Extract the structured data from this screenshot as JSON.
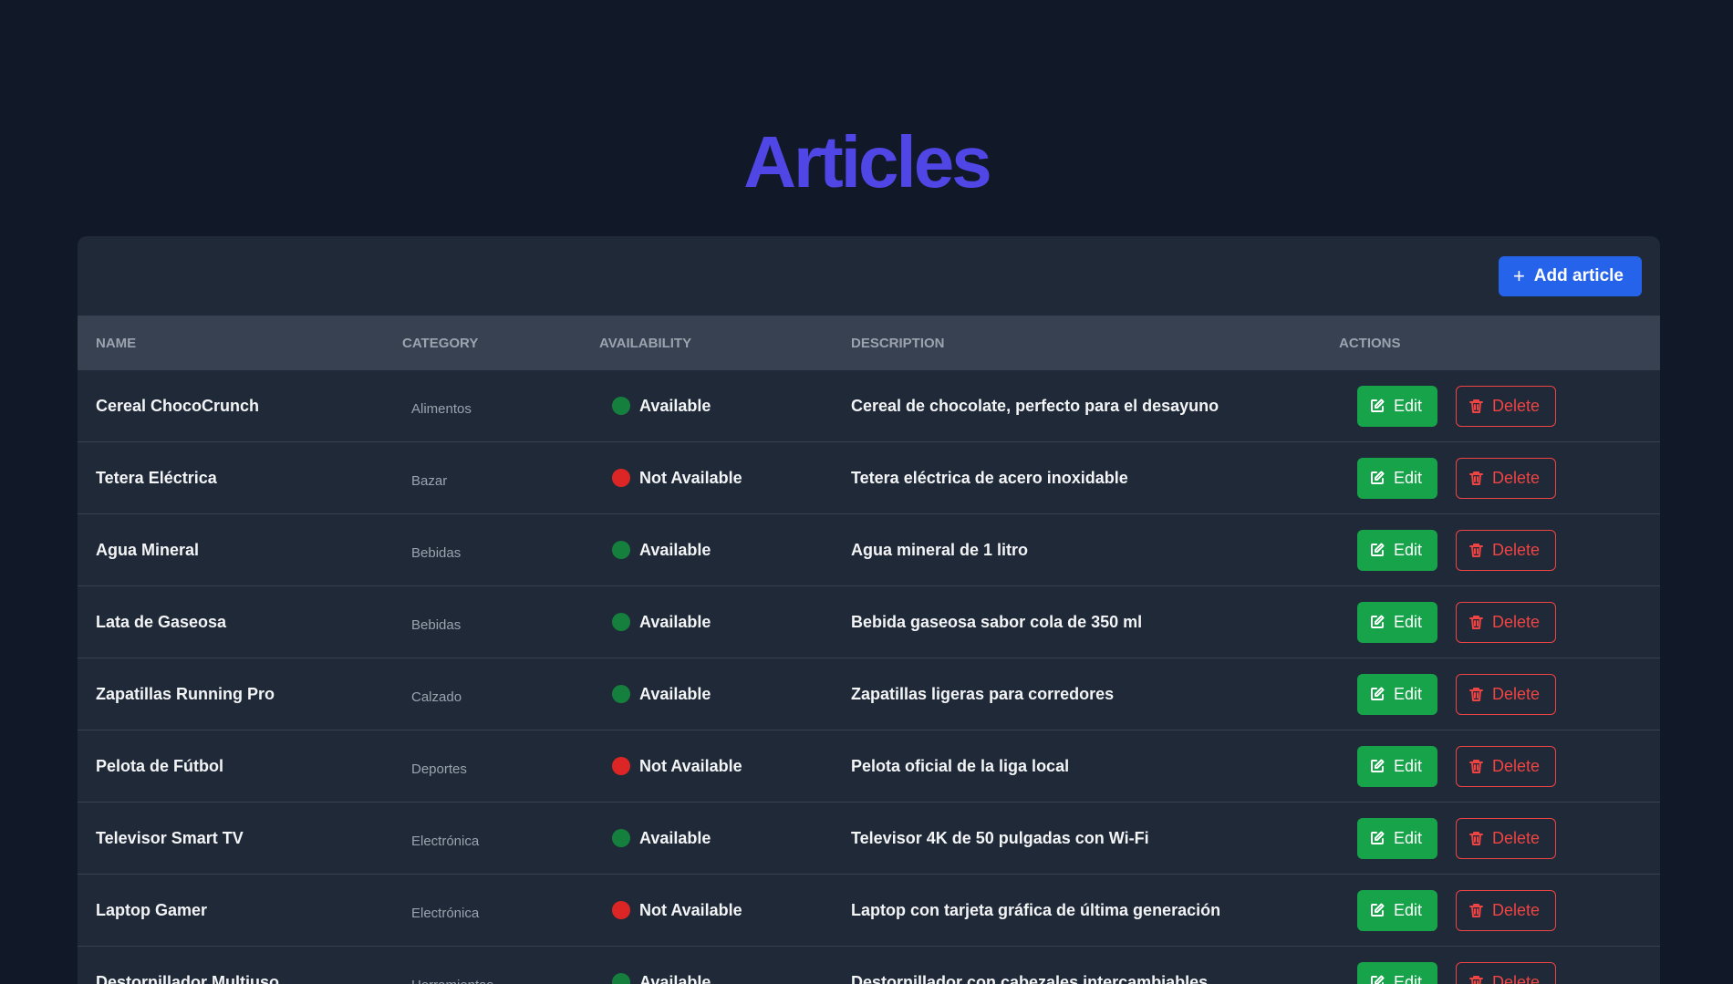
{
  "page": {
    "title": "Articles"
  },
  "toolbar": {
    "add_label": "Add article"
  },
  "table": {
    "headers": {
      "name": "NAME",
      "category": "CATEGORY",
      "availability": "AVAILABILITY",
      "description": "DESCRIPTION",
      "actions": "ACTIONS"
    },
    "edit_label": "Edit",
    "delete_label": "Delete",
    "rows": [
      {
        "name": "Cereal ChocoCrunch",
        "category": "Alimentos",
        "availability": "Available",
        "available": true,
        "description": "Cereal de chocolate, perfecto para el desayuno"
      },
      {
        "name": "Tetera Eléctrica",
        "category": "Bazar",
        "availability": "Not Available",
        "available": false,
        "description": "Tetera eléctrica de acero inoxidable"
      },
      {
        "name": "Agua Mineral",
        "category": "Bebidas",
        "availability": "Available",
        "available": true,
        "description": "Agua mineral de 1 litro"
      },
      {
        "name": "Lata de Gaseosa",
        "category": "Bebidas",
        "availability": "Available",
        "available": true,
        "description": "Bebida gaseosa sabor cola de 350 ml"
      },
      {
        "name": "Zapatillas Running Pro",
        "category": "Calzado",
        "availability": "Available",
        "available": true,
        "description": "Zapatillas ligeras para corredores"
      },
      {
        "name": "Pelota de Fútbol",
        "category": "Deportes",
        "availability": "Not Available",
        "available": false,
        "description": "Pelota oficial de la liga local"
      },
      {
        "name": "Televisor Smart TV",
        "category": "Electrónica",
        "availability": "Available",
        "available": true,
        "description": "Televisor 4K de 50 pulgadas con Wi-Fi"
      },
      {
        "name": "Laptop Gamer",
        "category": "Electrónica",
        "availability": "Not Available",
        "available": false,
        "description": "Laptop con tarjeta gráfica de última generación"
      },
      {
        "name": "Destornillador Multiuso",
        "category": "Herramientas",
        "availability": "Available",
        "available": true,
        "description": "Destornillador con cabezales intercambiables"
      }
    ]
  },
  "colors": {
    "available": "#15803d",
    "not_available": "#dc2626",
    "accent": "#4f46e5"
  },
  "icons": {
    "add": "plus-icon",
    "edit": "edit-icon",
    "delete": "trash-icon"
  }
}
